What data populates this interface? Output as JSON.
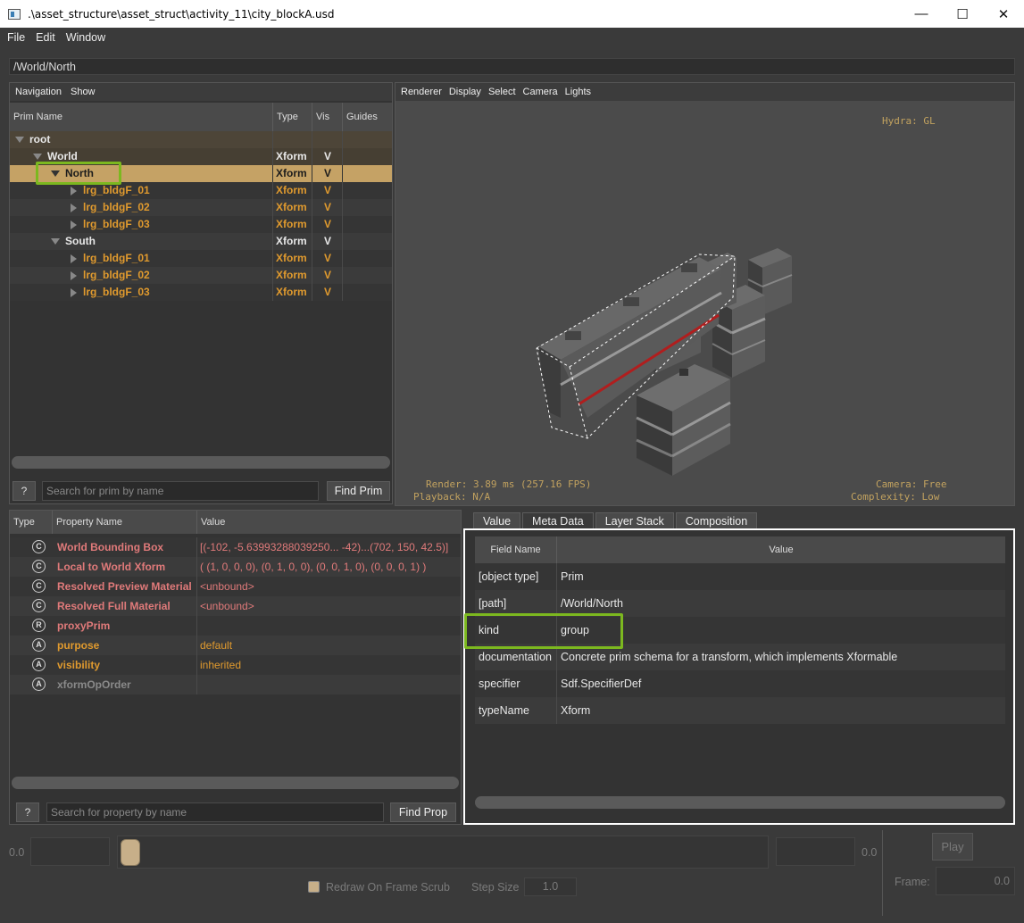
{
  "window": {
    "title": ".\\asset_structure\\asset_struct\\activity_11\\city_blockA.usd",
    "minimize": "—",
    "maximize": "☐",
    "close": "✕"
  },
  "menu": [
    "File",
    "Edit",
    "Window"
  ],
  "path": "/World/North",
  "tree": {
    "toolbar": [
      "Navigation",
      "Show"
    ],
    "headers": {
      "name": "Prim Name",
      "type": "Type",
      "vis": "Vis",
      "guides": "Guides"
    },
    "rows": [
      {
        "name": "root",
        "type": "",
        "vis": ""
      },
      {
        "name": "World",
        "type": "Xform",
        "vis": "V"
      },
      {
        "name": "North",
        "type": "Xform",
        "vis": "V"
      },
      {
        "name": "lrg_bldgF_01",
        "type": "Xform",
        "vis": "V"
      },
      {
        "name": "lrg_bldgF_02",
        "type": "Xform",
        "vis": "V"
      },
      {
        "name": "lrg_bldgF_03",
        "type": "Xform",
        "vis": "V"
      },
      {
        "name": "South",
        "type": "Xform",
        "vis": "V"
      },
      {
        "name": "lrg_bldgF_01",
        "type": "Xform",
        "vis": "V"
      },
      {
        "name": "lrg_bldgF_02",
        "type": "Xform",
        "vis": "V"
      },
      {
        "name": "lrg_bldgF_03",
        "type": "Xform",
        "vis": "V"
      }
    ],
    "help": "?",
    "search_placeholder": "Search for prim by name",
    "find_button": "Find Prim"
  },
  "viewport": {
    "toolbar": [
      "Renderer",
      "Display",
      "Select",
      "Camera",
      "Lights"
    ],
    "hud_renderer": "Hydra: GL",
    "hud_render": "Render: 3.89 ms (257.16 FPS)",
    "hud_playback": "Playback: N/A",
    "hud_camera": "Camera: Free",
    "hud_complexity": "Complexity: Low"
  },
  "properties": {
    "headers": {
      "type": "Type",
      "name": "Property Name",
      "value": "Value"
    },
    "rows": [
      {
        "badge": "C",
        "name": "World Bounding Box",
        "value": "[(-102, -5.63993288039250... -42)...(702, 150, 42.5)]"
      },
      {
        "badge": "C",
        "name": "Local to World Xform",
        "value": "( (1, 0, 0, 0), (0, 1, 0, 0), (0, 0, 1, 0), (0, 0, 0, 1) )"
      },
      {
        "badge": "C",
        "name": "Resolved Preview Material",
        "value": "<unbound>"
      },
      {
        "badge": "C",
        "name": "Resolved Full Material",
        "value": "<unbound>"
      },
      {
        "badge": "R",
        "name": "proxyPrim",
        "value": ""
      },
      {
        "badge": "A",
        "name": "purpose",
        "value": "default"
      },
      {
        "badge": "A",
        "name": "visibility",
        "value": "inherited"
      },
      {
        "badge": "A",
        "name": "xformOpOrder",
        "value": ""
      }
    ],
    "help": "?",
    "search_placeholder": "Search for property by name",
    "find_button": "Find Prop"
  },
  "metadata": {
    "tabs": [
      "Value",
      "Meta Data",
      "Layer Stack",
      "Composition"
    ],
    "active_tab": "Meta Data",
    "headers": {
      "field": "Field Name",
      "value": "Value"
    },
    "rows": [
      {
        "field": "[object type]",
        "value": "Prim"
      },
      {
        "field": "[path]",
        "value": "/World/North"
      },
      {
        "field": "kind",
        "value": "group"
      },
      {
        "field": "documentation",
        "value": "Concrete prim schema for a transform, which implements Xformable"
      },
      {
        "field": "specifier",
        "value": "Sdf.SpecifierDef"
      },
      {
        "field": "typeName",
        "value": "Xform"
      }
    ]
  },
  "timeline": {
    "start": "0.0",
    "end": "0.0",
    "play_button": "Play",
    "frame_label": "Frame:",
    "frame_value": "0.0",
    "redraw_label": "Redraw On Frame Scrub",
    "step_label": "Step Size",
    "step_value": "1.0"
  },
  "colors": {
    "selection": "#c5a265",
    "highlight": "#7cb81f",
    "prim_orange": "#e09a2e",
    "computed_red": "#e07a7a"
  }
}
